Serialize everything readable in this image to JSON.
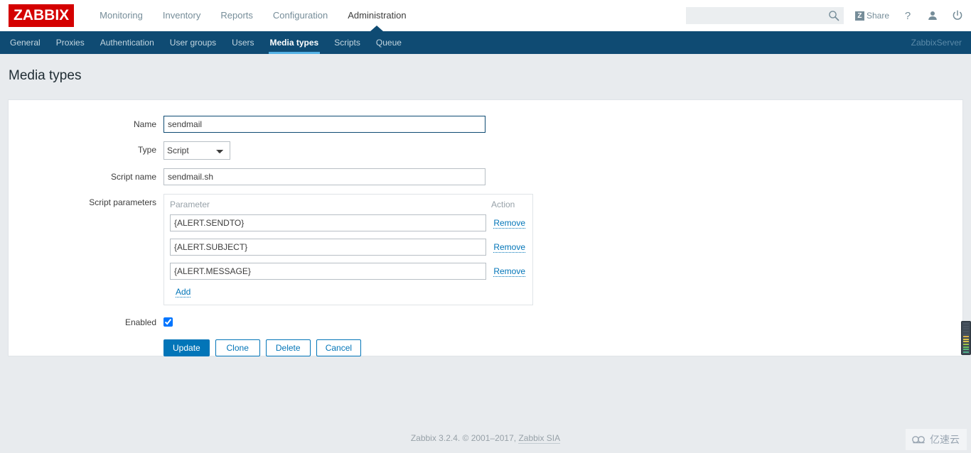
{
  "header": {
    "logo": "ZABBIX",
    "main_nav": [
      {
        "label": "Monitoring",
        "active": false
      },
      {
        "label": "Inventory",
        "active": false
      },
      {
        "label": "Reports",
        "active": false
      },
      {
        "label": "Configuration",
        "active": false
      },
      {
        "label": "Administration",
        "active": true
      }
    ],
    "search": {
      "value": "",
      "placeholder": ""
    },
    "share_label": "Share",
    "share_badge": "Z",
    "help_icon": "question-mark-icon",
    "user_icon": "user-icon",
    "power_icon": "power-icon"
  },
  "subnav": {
    "items": [
      {
        "label": "General",
        "active": false
      },
      {
        "label": "Proxies",
        "active": false
      },
      {
        "label": "Authentication",
        "active": false
      },
      {
        "label": "User groups",
        "active": false
      },
      {
        "label": "Users",
        "active": false
      },
      {
        "label": "Media types",
        "active": true
      },
      {
        "label": "Scripts",
        "active": false
      },
      {
        "label": "Queue",
        "active": false
      }
    ],
    "server": "ZabbixServer"
  },
  "page": {
    "title": "Media types"
  },
  "form": {
    "name_label": "Name",
    "name_value": "sendmail",
    "type_label": "Type",
    "type_value": "Script",
    "type_options": [
      "Script"
    ],
    "script_name_label": "Script name",
    "script_name_value": "sendmail.sh",
    "script_params_label": "Script parameters",
    "params_col_parameter": "Parameter",
    "params_col_action": "Action",
    "params": [
      {
        "value": "{ALERT.SENDTO}",
        "action": "Remove"
      },
      {
        "value": "{ALERT.SUBJECT}",
        "action": "Remove"
      },
      {
        "value": "{ALERT.MESSAGE}",
        "action": "Remove"
      }
    ],
    "add_label": "Add",
    "enabled_label": "Enabled",
    "enabled_checked": true,
    "buttons": [
      {
        "label": "Update",
        "style": "primary"
      },
      {
        "label": "Clone",
        "style": "secondary"
      },
      {
        "label": "Delete",
        "style": "secondary"
      },
      {
        "label": "Cancel",
        "style": "secondary"
      }
    ]
  },
  "footer": {
    "text": "Zabbix 3.2.4. © 2001–2017, ",
    "link": "Zabbix SIA"
  },
  "watermark": {
    "text": "亿速云"
  },
  "colors": {
    "brand_red": "#d40000",
    "nav_blue": "#0f4b73",
    "accent_blue": "#0275b8",
    "active_underline": "#55b2e5",
    "page_bg": "#e8ebee"
  },
  "meter": {
    "segments": [
      "#4a5561",
      "#4a5561",
      "#4a5561",
      "#4a5561",
      "#4a5561",
      "#d8b04a",
      "#d8c24a",
      "#d8c24a",
      "#9fc24a",
      "#6fbf5a",
      "#5ab87a",
      "#4fae8a"
    ]
  }
}
